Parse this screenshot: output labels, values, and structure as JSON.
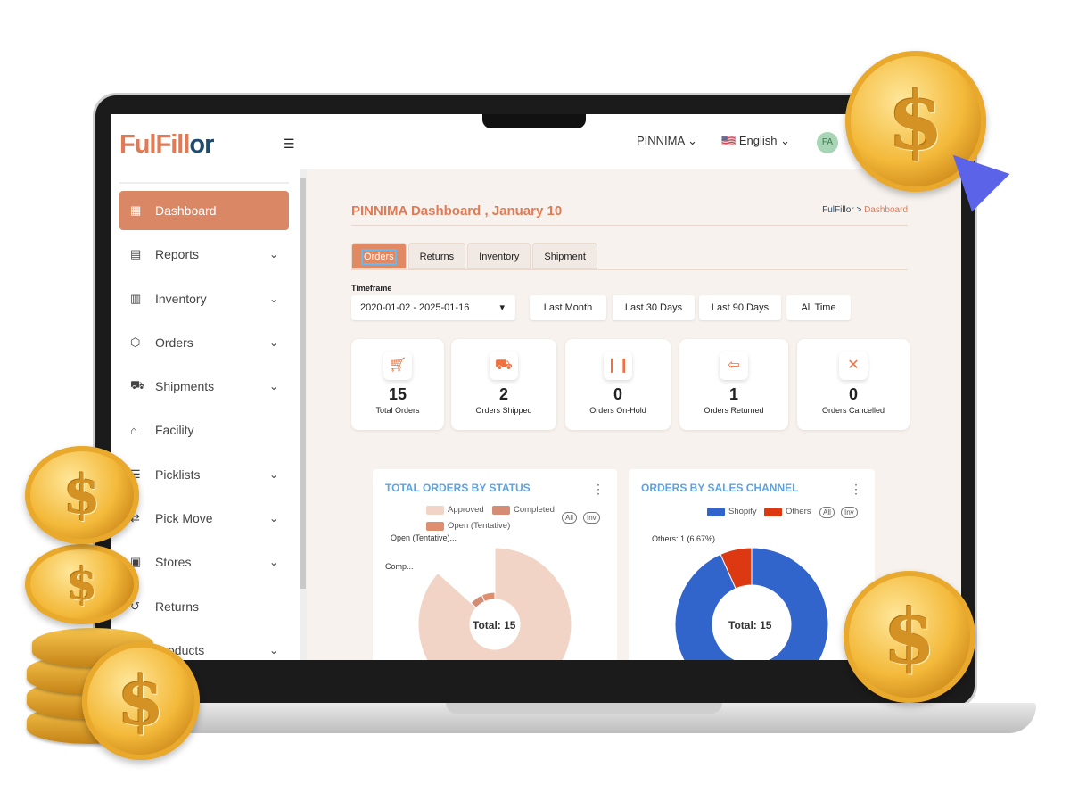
{
  "app": {
    "logo_main": "FulFill",
    "logo_accent": "or",
    "user_menu": "PINNIMA",
    "language": "English",
    "avatar_initials": "FA"
  },
  "sidebar": {
    "items": [
      {
        "label": "Dashboard",
        "icon": "dashboard-icon",
        "active": true,
        "expandable": false
      },
      {
        "label": "Reports",
        "icon": "reports-icon",
        "expandable": true
      },
      {
        "label": "Inventory",
        "icon": "inventory-icon",
        "expandable": true
      },
      {
        "label": "Orders",
        "icon": "orders-icon",
        "expandable": true
      },
      {
        "label": "Shipments",
        "icon": "shipments-icon",
        "expandable": true
      },
      {
        "label": "Facility",
        "icon": "facility-icon",
        "expandable": false
      },
      {
        "label": "Picklists",
        "icon": "picklists-icon",
        "expandable": true
      },
      {
        "label": "Pick Move",
        "icon": "pick-move-icon",
        "expandable": true
      },
      {
        "label": "Stores",
        "icon": "stores-icon",
        "expandable": true
      },
      {
        "label": "Returns",
        "icon": "returns-icon",
        "expandable": false
      },
      {
        "label": "Products",
        "icon": "products-icon",
        "expandable": true
      }
    ]
  },
  "page": {
    "title": "PINNIMA Dashboard , January 10",
    "breadcrumb": [
      "FulFillor",
      "Dashboard"
    ]
  },
  "tabs": [
    "Orders",
    "Returns",
    "Inventory",
    "Shipment"
  ],
  "timeframe": {
    "label": "Timeframe",
    "value": "2020-01-02 - 2025-01-16",
    "presets": [
      "Last Month",
      "Last 30 Days",
      "Last 90 Days",
      "All Time"
    ]
  },
  "stats": [
    {
      "value": "15",
      "label": "Total Orders",
      "icon": "cart-icon"
    },
    {
      "value": "2",
      "label": "Orders Shipped",
      "icon": "truck-icon"
    },
    {
      "value": "0",
      "label": "Orders On-Hold",
      "icon": "pause-icon"
    },
    {
      "value": "1",
      "label": "Orders Returned",
      "icon": "return-clipboard-icon"
    },
    {
      "value": "0",
      "label": "Orders Cancelled",
      "icon": "cart-cancel-icon"
    }
  ],
  "chart_data": [
    {
      "type": "pie",
      "title": "TOTAL ORDERS BY STATUS",
      "center_label": "Total: 15",
      "legend": [
        "Approved",
        "Completed",
        "Open (Tentative)"
      ],
      "toggles": [
        "All",
        "Inv"
      ],
      "slice_labels": [
        "Open (Tentative)...",
        "Comp..."
      ],
      "series": [
        {
          "name": "Approved",
          "value": 13,
          "color": "#f2d4c6"
        },
        {
          "name": "Completed",
          "value": 1,
          "color": "#d48c74"
        },
        {
          "name": "Open (Tentative)",
          "value": 1,
          "color": "#df8e70"
        }
      ]
    },
    {
      "type": "pie",
      "title": "ORDERS BY SALES CHANNEL",
      "center_label": "Total: 15",
      "legend": [
        "Shopify",
        "Others"
      ],
      "toggles": [
        "All",
        "Inv"
      ],
      "slice_labels": [
        "Others: 1 (6.67%)"
      ],
      "series": [
        {
          "name": "Shopify",
          "value": 14,
          "color": "#3165cc"
        },
        {
          "name": "Others",
          "value": 1,
          "color": "#dc3912"
        }
      ]
    }
  ]
}
